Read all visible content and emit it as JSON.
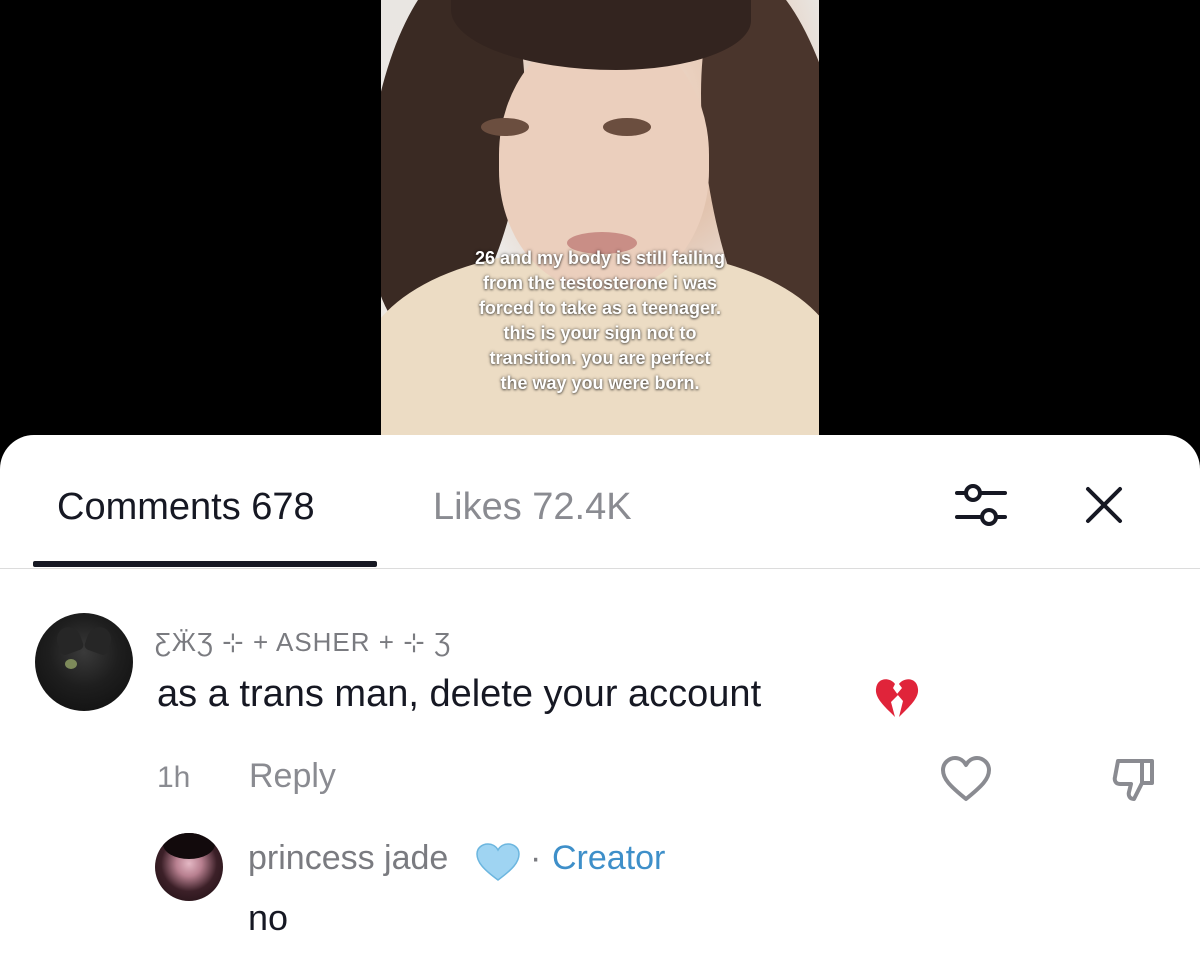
{
  "video": {
    "caption": "26 and my body is still failing\nfrom the testosterone i was\nforced to take as a teenager.\nthis is your sign not to\ntransition. you are perfect\nthe way you were born."
  },
  "tabs": {
    "comments_label": "Comments 678",
    "likes_label": "Likes 72.4K"
  },
  "icons": {
    "filter": "sliders-icon",
    "close": "close-icon",
    "like": "heart-outline-icon",
    "dislike": "thumbs-down-icon",
    "broken_heart": "broken-heart-emoji",
    "blue_heart": "blue-heart-emoji"
  },
  "comment": {
    "username": "ƸӜƷ ⊹ + ASHER + ⊹ Ʒ",
    "text": "as a trans man, delete your account",
    "time": "1h",
    "reply_label": "Reply"
  },
  "reply": {
    "username": "princess jade",
    "separator": "·",
    "badge": "Creator",
    "text": "no"
  },
  "colors": {
    "primary_text": "#161823",
    "secondary_text": "#8a8b91",
    "creator_blue": "#3e8fc9",
    "emoji_red": "#e0243a",
    "emoji_blue": "#9fd4f2"
  }
}
